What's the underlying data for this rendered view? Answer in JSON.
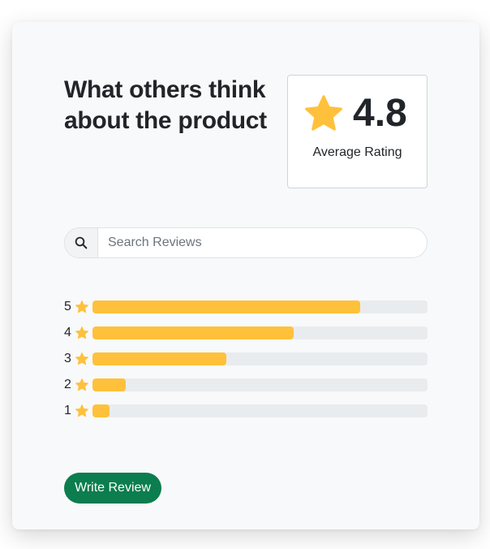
{
  "header": {
    "title": "What others think about the product"
  },
  "rating": {
    "value": "4.8",
    "label": "Average Rating",
    "star_color": "#ffc13b"
  },
  "search": {
    "placeholder": "Search Reviews",
    "value": "",
    "icon": "search-icon"
  },
  "breakdown": {
    "bar_color": "#ffc13b",
    "track_color": "#e9ecef",
    "rows": [
      {
        "stars": "5",
        "fraction": 0.8
      },
      {
        "stars": "4",
        "fraction": 0.6
      },
      {
        "stars": "3",
        "fraction": 0.4
      },
      {
        "stars": "2",
        "fraction": 0.1
      },
      {
        "stars": "1",
        "fraction": 0.05
      }
    ]
  },
  "actions": {
    "write_review_label": "Write Review",
    "button_color": "#0b7d4e"
  }
}
